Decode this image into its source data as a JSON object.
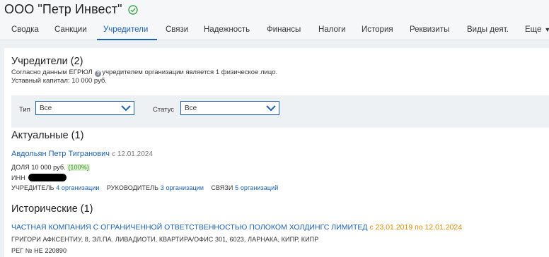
{
  "company": {
    "title": "ООО \"Петр Инвест\""
  },
  "tabs": [
    {
      "label": "Сводка"
    },
    {
      "label": "Санкции"
    },
    {
      "label": "Учредители"
    },
    {
      "label": "Связи"
    },
    {
      "label": "Надежность"
    },
    {
      "label": "Финансы"
    },
    {
      "label": "Налоги"
    },
    {
      "label": "История"
    },
    {
      "label": "Реквизиты"
    },
    {
      "label": "Виды деят."
    },
    {
      "label": "Еще"
    }
  ],
  "active_tab": "Учредители",
  "founders": {
    "heading": "Учредители (2)",
    "note_prefix": "Согласно данным ЕГРЮЛ",
    "note_suffix": "учредителем организации является 1 физическое лицо.",
    "capital": "Уставный капитал: 10 000 руб."
  },
  "filters": {
    "type_label": "Тип",
    "type_value": "Все",
    "status_label": "Статус",
    "status_value": "Все"
  },
  "current": {
    "heading": "Актуальные (1)",
    "name": "Авдольян Петр Тигранович",
    "date": "с 12.01.2024",
    "share_label": "ДОЛЯ",
    "share_value": "10 000 руб.",
    "share_percent": "(100%)",
    "inn_label": "ИНН",
    "founder_label": "УЧРЕДИТЕЛЬ",
    "founder_link": "4 организации",
    "head_label": "РУКОВОДИТЕЛЬ",
    "head_link": "3 организации",
    "links_label": "СВЯЗИ",
    "links_link": "5 организаций"
  },
  "historical": {
    "heading": "Исторические (1)",
    "name": "ЧАСТНАЯ КОМПАНИЯ С ОГРАНИЧЕННОЙ ОТВЕТСТВЕННОСТЬЮ ПОЛОКОМ ХОЛДИНГС ЛИМИТЕД",
    "period": "с 23.01.2019 по 12.01.2024",
    "address": "ГРИГОРИ АФКСЕНТИУ, 8, ЭЛ.ПА. ЛИВАДИОТИ, КВАРТИРА/ОФИС 301, 6023, ЛАРНАКА, КИПР, КИПР",
    "reg_label": "РЕГ №",
    "reg_value": "HE 220890"
  },
  "colors": {
    "accent": "#1a5fb4",
    "verified": "#3aa54a",
    "period": "#e08a00"
  },
  "icons": {
    "verified": "check-circle-icon",
    "info": "info-icon",
    "dropdown": "chevron-down-icon"
  }
}
